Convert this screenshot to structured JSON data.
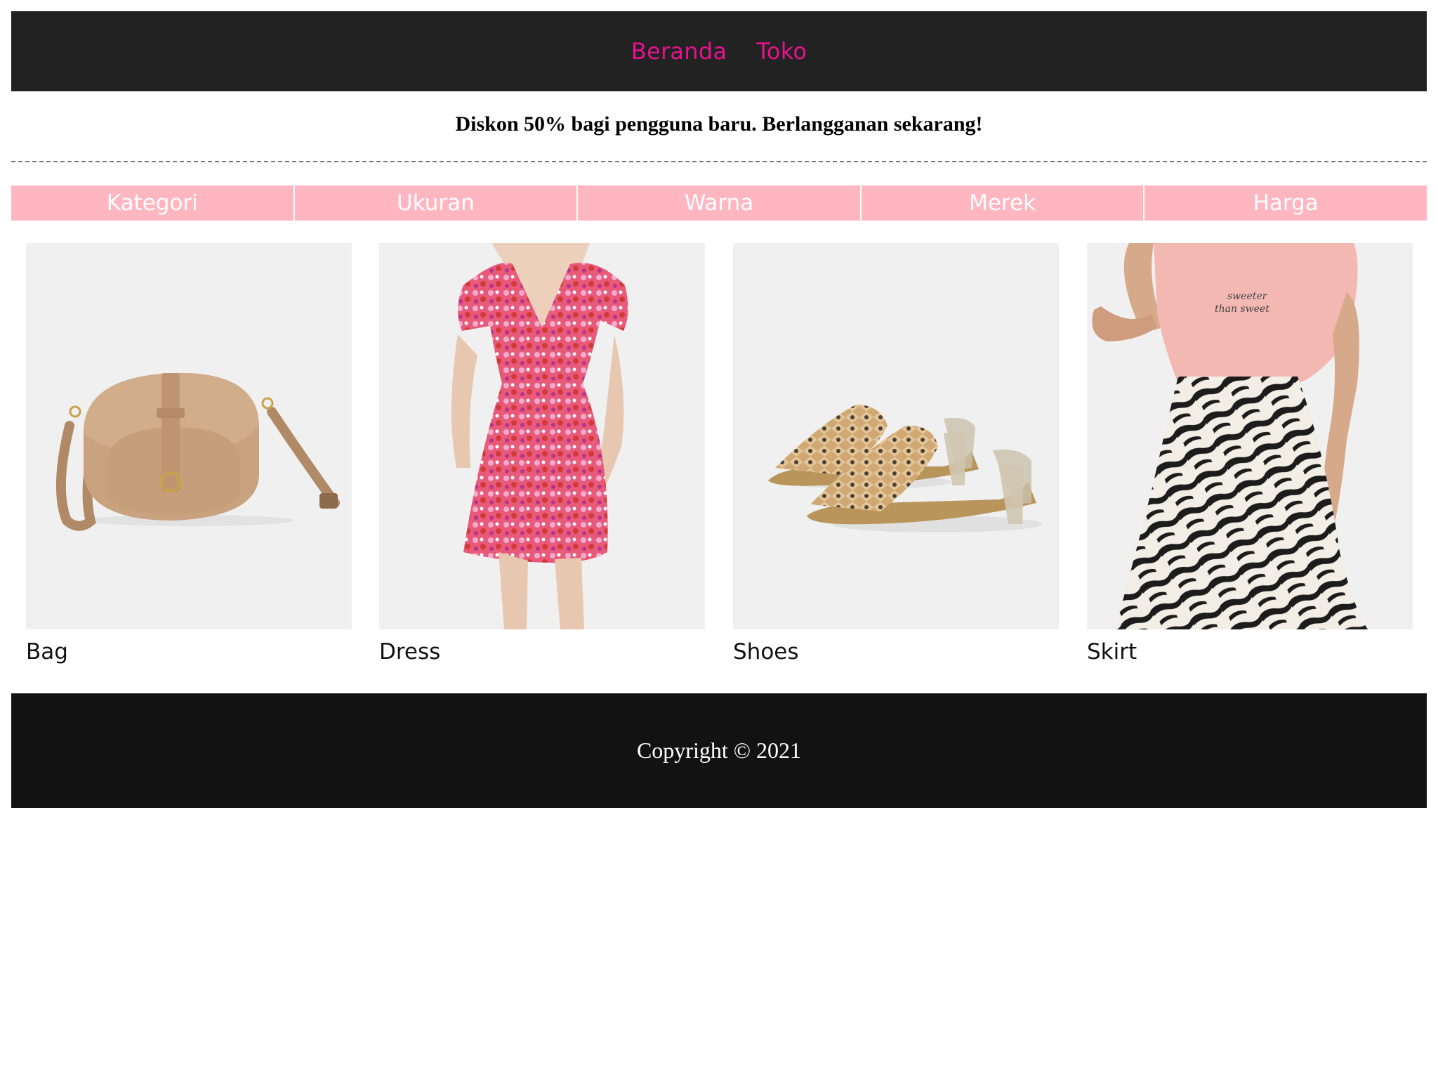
{
  "nav": {
    "items": [
      {
        "label": "Beranda"
      },
      {
        "label": "Toko"
      }
    ],
    "link_color": "#e8128c",
    "background": "#222222"
  },
  "promo": {
    "text": "Diskon 50% bagi pengguna baru. Berlangganan sekarang!"
  },
  "filters": {
    "background": "#ffb6c1",
    "items": [
      {
        "label": "Kategori"
      },
      {
        "label": "Ukuran"
      },
      {
        "label": "Warna"
      },
      {
        "label": "Merek"
      },
      {
        "label": "Harga"
      }
    ]
  },
  "products": [
    {
      "name": "Bag",
      "image_icon": "bag-image"
    },
    {
      "name": "Dress",
      "image_icon": "dress-image"
    },
    {
      "name": "Shoes",
      "image_icon": "shoes-image"
    },
    {
      "name": "Skirt",
      "image_icon": "skirt-image"
    }
  ],
  "footer": {
    "copyright": "Copyright © 2021"
  }
}
